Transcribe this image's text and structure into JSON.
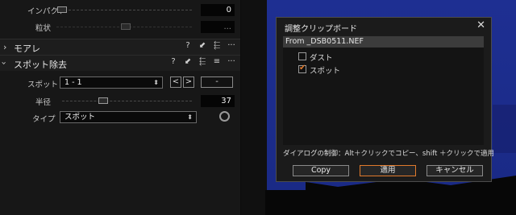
{
  "adjust_panel": {
    "impact": {
      "label": "インパクト",
      "value": "0"
    },
    "grain": {
      "label": "粒状",
      "value": "..."
    },
    "moire": {
      "title": "モアレ"
    },
    "spot": {
      "title": "スポット除去",
      "spot_label": "スポット",
      "spot_value": "1 - 1",
      "prev_btn": "<",
      "next_btn": ">",
      "remove_btn": "-",
      "radius_label": "半径",
      "radius_value": "37",
      "type_label": "タイプ",
      "type_value": "スポット"
    },
    "header_icons": {
      "help": "?",
      "reset_arrow": "⬋",
      "copy": "⬱",
      "menu": "≡",
      "more": "···"
    }
  },
  "dialog": {
    "title": "調整クリップボード",
    "close": "✕",
    "source_item": "From _DSB0511.NEF",
    "items": [
      {
        "label": "ダスト",
        "checked": false
      },
      {
        "label": "スポット",
        "checked": true
      }
    ],
    "hint": "ダイアログの制御：Alt＋クリックでコピー、shift ＋クリックで適用",
    "buttons": {
      "copy": "Copy",
      "apply": "適用",
      "cancel": "キャンセル"
    }
  },
  "colors": {
    "accent": "#e07a2c",
    "sky": "#1b2a8a"
  }
}
